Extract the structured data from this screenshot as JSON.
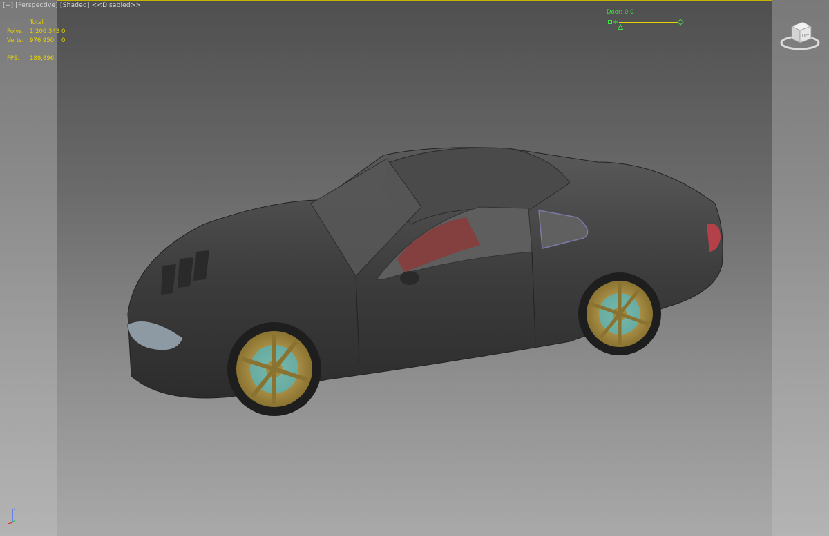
{
  "viewport": {
    "label": {
      "plus": "[+]",
      "view": "[Perspective]",
      "shading": "[Shaded]",
      "extra": "<<Disabled>>"
    },
    "stats": {
      "total_label": "Total",
      "polys_label": "Polys:",
      "polys_value": "1 206 343",
      "polys_sel": "0",
      "verts_label": "Verts:",
      "verts_value": "976 950",
      "verts_sel": "0",
      "fps_label": "FPS:",
      "fps_value": "189,896"
    },
    "slider": {
      "label": "Door: 0.0",
      "value": 0.0
    },
    "viewcube": {
      "face_label": "LIFT",
      "icon": "viewcube-icon"
    },
    "axis_icon": "axis-tripod-icon"
  },
  "colors": {
    "safe_frame": "#c8b400",
    "stats_text": "#e6d200",
    "slider": "#3fe03f",
    "car_body": "#3f3f3f",
    "wheel_gold": "#b59a45",
    "brake_caliper": "#4fb8c8",
    "seat_red": "#8b3a3a"
  }
}
